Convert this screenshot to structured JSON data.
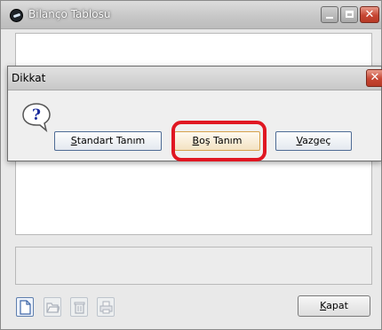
{
  "window": {
    "title": "Bilanço Tablosu",
    "close_glyph": "✕",
    "kapat_first": "K",
    "kapat_rest": "apat"
  },
  "dialog": {
    "title": "Dikkat",
    "close_glyph": "✕",
    "icon": "question-icon",
    "buttons": {
      "standart_first": "S",
      "standart_rest": "tandart Tanım",
      "bos_first": "B",
      "bos_rest": "oş Tanım",
      "vazgec_first": "V",
      "vazgec_rest": "azgeç"
    }
  },
  "toolbar_icons": [
    "new-document-icon",
    "open-folder-icon",
    "trash-icon",
    "print-icon"
  ],
  "colors": {
    "highlight": "#e01722",
    "close_button": "#c64633"
  }
}
